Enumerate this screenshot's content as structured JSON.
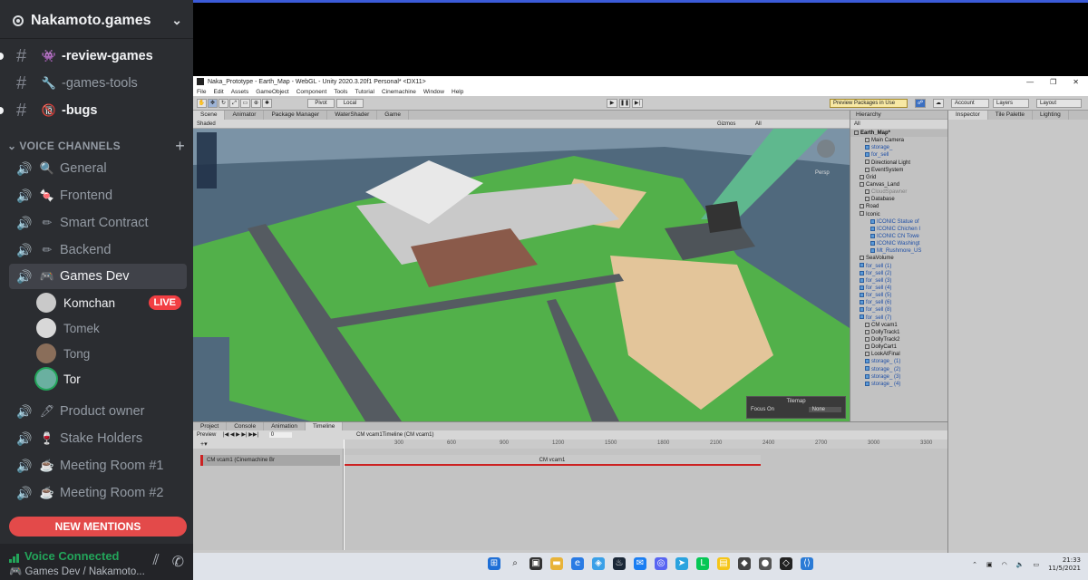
{
  "discord": {
    "server_name": "Nakamoto.games",
    "text_channels": [
      {
        "label": "-review-games",
        "emoji": "👾",
        "bright": true
      },
      {
        "label": "-games-tools",
        "emoji": "🔧",
        "bright": false
      },
      {
        "label": "-bugs",
        "emoji": "🔞",
        "bright": true
      }
    ],
    "voice_header": "VOICE CHANNELS",
    "voice_channels": [
      {
        "label": "General",
        "emoji": "🔍"
      },
      {
        "label": "Frontend",
        "emoji": "🍬"
      },
      {
        "label": "Smart Contract",
        "emoji": "✏"
      },
      {
        "label": "Backend",
        "emoji": "✏"
      },
      {
        "label": "Games Dev",
        "emoji": "🎮",
        "active": true
      }
    ],
    "voice_users": [
      {
        "name": "Komchan",
        "live": true,
        "live_label": "LIVE"
      },
      {
        "name": "Tomek"
      },
      {
        "name": "Tong"
      },
      {
        "name": "Tor",
        "speaking": true
      }
    ],
    "more_channels": [
      {
        "label": "Product owner",
        "emoji": "🖊"
      },
      {
        "label": "Stake Holders",
        "emoji": "🍷"
      },
      {
        "label": "Meeting Room #1",
        "emoji": "☕"
      },
      {
        "label": "Meeting Room #2",
        "emoji": "☕"
      }
    ],
    "new_mentions": "NEW MENTIONS",
    "voice_connected": "Voice Connected",
    "voice_location": "Games Dev / Nakamoto..."
  },
  "unity": {
    "window_title": "Naka_Prototype - Earth_Map - WebGL - Unity 2020.3.20f1 Personal* <DX11>",
    "menu": [
      "File",
      "Edit",
      "Assets",
      "GameObject",
      "Component",
      "Tools",
      "Tutorial",
      "Cinemachine",
      "Window",
      "Help"
    ],
    "toolbar": {
      "pivot": "Pivot",
      "local": "Local",
      "preview_packages": "Preview Packages in Use",
      "account": "Account",
      "layers": "Layers",
      "layout": "Layout"
    },
    "scene_tabs": [
      "Scene",
      "Animator",
      "Package Manager",
      "WaterShader",
      "Game"
    ],
    "scene_bar": {
      "shading": "Shaded",
      "gizmos": "Gizmos",
      "search": "All",
      "persp": "Persp"
    },
    "hierarchy": {
      "title": "Hierarchy",
      "search": "All",
      "items": [
        {
          "label": "Earth_Map*",
          "kind": "root",
          "indent": 0
        },
        {
          "label": "Main Camera",
          "kind": "normal",
          "indent": 2
        },
        {
          "label": "storage_",
          "kind": "prefab",
          "indent": 2
        },
        {
          "label": "for_sell",
          "kind": "prefab",
          "indent": 2
        },
        {
          "label": "Directional Light",
          "kind": "normal",
          "indent": 2
        },
        {
          "label": "EventSystem",
          "kind": "normal",
          "indent": 2
        },
        {
          "label": "Grid",
          "kind": "normal",
          "indent": 1
        },
        {
          "label": "Canvas_Land",
          "kind": "normal",
          "indent": 1
        },
        {
          "label": "CloudSpawner",
          "kind": "disabled",
          "indent": 2
        },
        {
          "label": "Database",
          "kind": "normal",
          "indent": 2
        },
        {
          "label": "Road",
          "kind": "normal",
          "indent": 1
        },
        {
          "label": "Iconic",
          "kind": "normal",
          "indent": 1
        },
        {
          "label": "ICONIC Statue of",
          "kind": "prefab",
          "indent": 3
        },
        {
          "label": "ICONIC Chichen I",
          "kind": "prefab",
          "indent": 3
        },
        {
          "label": "ICONIC CN Towe",
          "kind": "prefab",
          "indent": 3
        },
        {
          "label": "ICONIC Washingt",
          "kind": "prefab",
          "indent": 3
        },
        {
          "label": "Mt_Rushmore_US",
          "kind": "prefab",
          "indent": 3
        },
        {
          "label": "SeaVolume",
          "kind": "normal",
          "indent": 1
        },
        {
          "label": "for_sell (1)",
          "kind": "prefab",
          "indent": 1
        },
        {
          "label": "for_sell (2)",
          "kind": "prefab",
          "indent": 1
        },
        {
          "label": "for_sell (3)",
          "kind": "prefab",
          "indent": 1
        },
        {
          "label": "for_sell (4)",
          "kind": "prefab",
          "indent": 1
        },
        {
          "label": "for_sell (5)",
          "kind": "prefab",
          "indent": 1
        },
        {
          "label": "for_sell (6)",
          "kind": "prefab",
          "indent": 1
        },
        {
          "label": "for_sell (8)",
          "kind": "prefab",
          "indent": 1
        },
        {
          "label": "for_sell (7)",
          "kind": "prefab",
          "indent": 1
        },
        {
          "label": "CM vcam1",
          "kind": "normal",
          "indent": 2
        },
        {
          "label": "DollyTrack1",
          "kind": "normal",
          "indent": 2
        },
        {
          "label": "DollyTrack2",
          "kind": "normal",
          "indent": 2
        },
        {
          "label": "DollyCart1",
          "kind": "normal",
          "indent": 2
        },
        {
          "label": "LookAtFinal",
          "kind": "normal",
          "indent": 2
        },
        {
          "label": "storage_ (1)",
          "kind": "prefab",
          "indent": 2
        },
        {
          "label": "storage_ (2)",
          "kind": "prefab",
          "indent": 2
        },
        {
          "label": "storage_ (3)",
          "kind": "prefab",
          "indent": 2
        },
        {
          "label": "storage_ (4)",
          "kind": "prefab",
          "indent": 2
        }
      ]
    },
    "inspector_tabs": [
      "Inspector",
      "Tile Palette",
      "Lighting"
    ],
    "tilemap": {
      "title": "Tilemap",
      "focus_label": "Focus On",
      "focus_value": "None"
    },
    "timeline_tabs": [
      "Project",
      "Console",
      "Animation",
      "Timeline"
    ],
    "timeline": {
      "preview": "Preview",
      "frame": "0",
      "asset": "CM vcam1Timeline (CM vcam1)",
      "track": "CM vcam1 (Cinemachine Br",
      "clip": "CM vcam1",
      "ruler": [
        "300",
        "600",
        "900",
        "1200",
        "1500",
        "1800",
        "2100",
        "2400",
        "2700",
        "3000",
        "3300"
      ]
    }
  },
  "taskbar": {
    "time": "21:33",
    "date": "11/5/2021"
  },
  "colors": {
    "discord_bg": "#2b2d31",
    "voice_green": "#23a55a",
    "live_red": "#f23f43",
    "mentions_red": "#e34a4a"
  }
}
